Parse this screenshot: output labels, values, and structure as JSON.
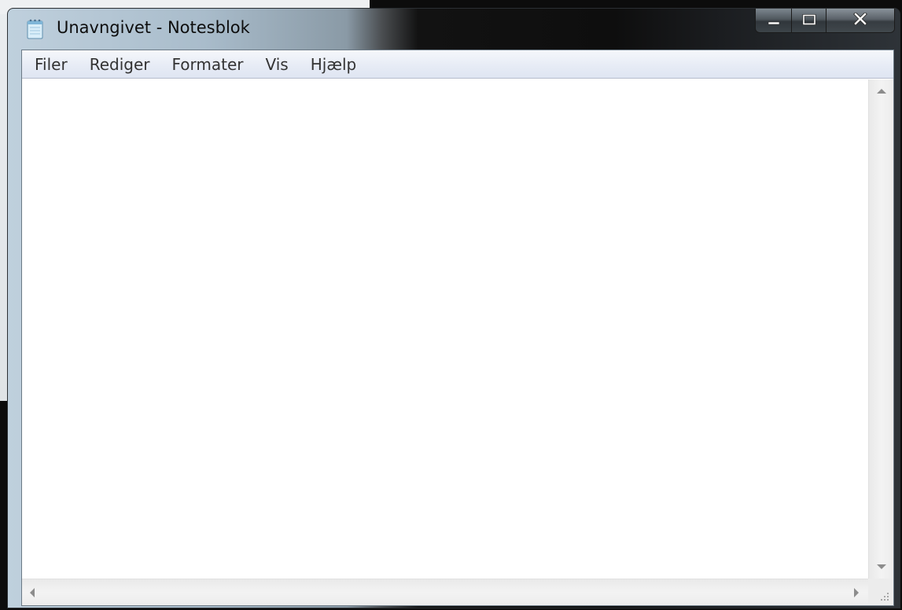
{
  "window": {
    "title": "Unavngivet - Notesblok",
    "app_icon": "notepad-icon",
    "caption_buttons": {
      "minimize_icon": "minimize-icon",
      "maximize_icon": "maximize-icon",
      "close_icon": "close-icon"
    }
  },
  "menubar": {
    "items": [
      {
        "label": "Filer"
      },
      {
        "label": "Rediger"
      },
      {
        "label": "Formater"
      },
      {
        "label": "Vis"
      },
      {
        "label": "Hjælp"
      }
    ]
  },
  "editor": {
    "value": ""
  },
  "scrollbars": {
    "vertical": {
      "up_icon": "scroll-up-icon",
      "down_icon": "scroll-down-icon"
    },
    "horizontal": {
      "left_icon": "scroll-left-icon",
      "right_icon": "scroll-right-icon"
    },
    "size_grip_icon": "size-grip-icon"
  },
  "colors": {
    "menubar_bg": "#e6ebf5",
    "editor_bg": "#ffffff",
    "title_text": "#0d0d0d"
  }
}
